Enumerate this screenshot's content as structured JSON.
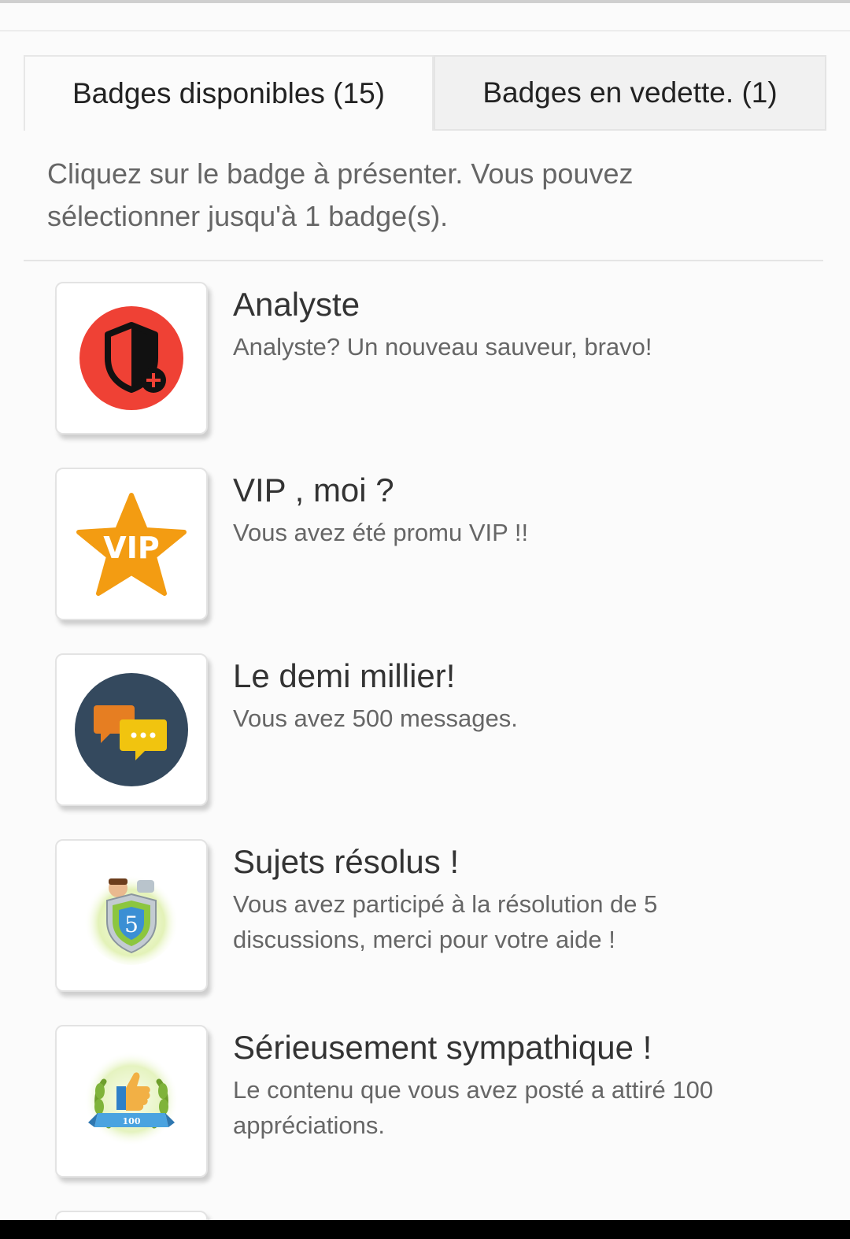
{
  "tabs": {
    "available": "Badges disponibles (15)",
    "featured": "Badges en vedette. (1)"
  },
  "instruction": "Cliquez sur le badge à présenter. Vous pouvez sélectionner jusqu'à 1 badge(s).",
  "badges": [
    {
      "title": "Analyste",
      "description": "Analyste? Un nouveau sauveur, bravo!",
      "icon": "shield-plus-icon"
    },
    {
      "title": "VIP , moi ?",
      "description": "Vous avez été promu VIP !!",
      "icon": "vip-star-icon",
      "icon_text": "VIP"
    },
    {
      "title": "Le demi millier!",
      "description": "Vous avez 500 messages.",
      "icon": "chat-bubbles-icon"
    },
    {
      "title": "Sujets résolus !",
      "description": "Vous avez participé à la résolution de 5 discussions, merci pour votre aide !",
      "icon": "resolved-shield-icon",
      "icon_text": "5"
    },
    {
      "title": "Sérieusement sympathique !",
      "description": "Le contenu que vous avez posté a attiré 100 appréciations.",
      "icon": "thumbs-up-laurel-icon",
      "icon_text": "100"
    }
  ],
  "colors": {
    "shield_red": "#ef4135",
    "vip_orange": "#f39c12",
    "chat_navy": "#34495e",
    "chat_orange": "#e67e22",
    "chat_yellow": "#f1c40f"
  }
}
